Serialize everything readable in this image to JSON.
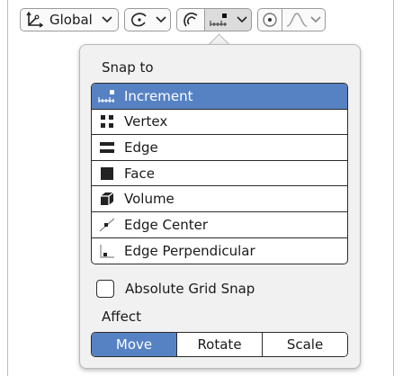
{
  "toolbar": {
    "orientation_label": "Global"
  },
  "snap_popup": {
    "snap_to_label": "Snap to",
    "items": [
      {
        "label": "Increment",
        "icon": "increment-icon",
        "selected": true
      },
      {
        "label": "Vertex",
        "icon": "vertex-icon",
        "selected": false
      },
      {
        "label": "Edge",
        "icon": "edge-icon",
        "selected": false
      },
      {
        "label": "Face",
        "icon": "face-icon",
        "selected": false
      },
      {
        "label": "Volume",
        "icon": "volume-icon",
        "selected": false
      },
      {
        "label": "Edge Center",
        "icon": "edge-center-icon",
        "selected": false
      },
      {
        "label": "Edge Perpendicular",
        "icon": "edge-perpendicular-icon",
        "selected": false
      }
    ],
    "absolute_grid_snap_label": "Absolute Grid Snap",
    "absolute_grid_snap_checked": false,
    "affect_label": "Affect",
    "affect_options": [
      "Move",
      "Rotate",
      "Scale"
    ],
    "affect_active": "Move"
  },
  "colors": {
    "accent": "#5682c4",
    "popup_bg": "#f1f1f1"
  }
}
